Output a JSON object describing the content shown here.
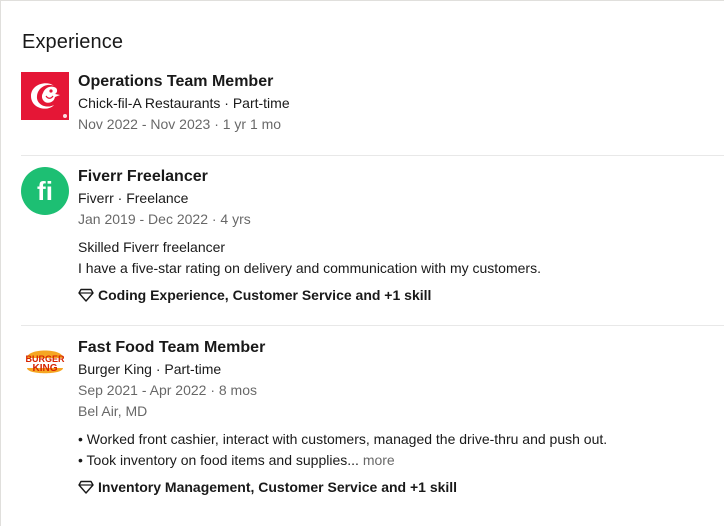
{
  "section": {
    "title": "Experience"
  },
  "experiences": [
    {
      "role": "Operations Team Member",
      "company": "Chick-fil-A Restaurants · Part-time",
      "dates": "Nov 2022 - Nov 2023 · 1 yr 1 mo",
      "logo_icon": "chick-fil-a-logo",
      "logo_color": "#e51636"
    },
    {
      "role": "Fiverr Freelancer",
      "company": "Fiverr · Freelance",
      "dates": "Jan 2019 - Dec 2022 · 4 yrs",
      "description": [
        "Skilled Fiverr freelancer",
        "I have a five-star rating on delivery and communication with my customers."
      ],
      "skills": "Coding Experience, Customer Service and +1 skill",
      "logo_icon": "fiverr-logo",
      "logo_text": "fi",
      "logo_color": "#1dbf73"
    },
    {
      "role": "Fast Food Team Member",
      "company": "Burger King · Part-time",
      "dates": "Sep 2021 - Apr 2022 · 8 mos",
      "location": "Bel Air, MD",
      "description": [
        "• Worked front cashier, interact with customers, managed the drive-thru and push out.",
        "• Took inventory on food items and supplies..."
      ],
      "more_label": "more",
      "skills": "Inventory Management, Customer Service and +1 skill",
      "logo_icon": "burger-king-logo",
      "logo_text_top": "BURGER",
      "logo_text_bottom": "KING",
      "logo_color": "#d62300"
    }
  ]
}
